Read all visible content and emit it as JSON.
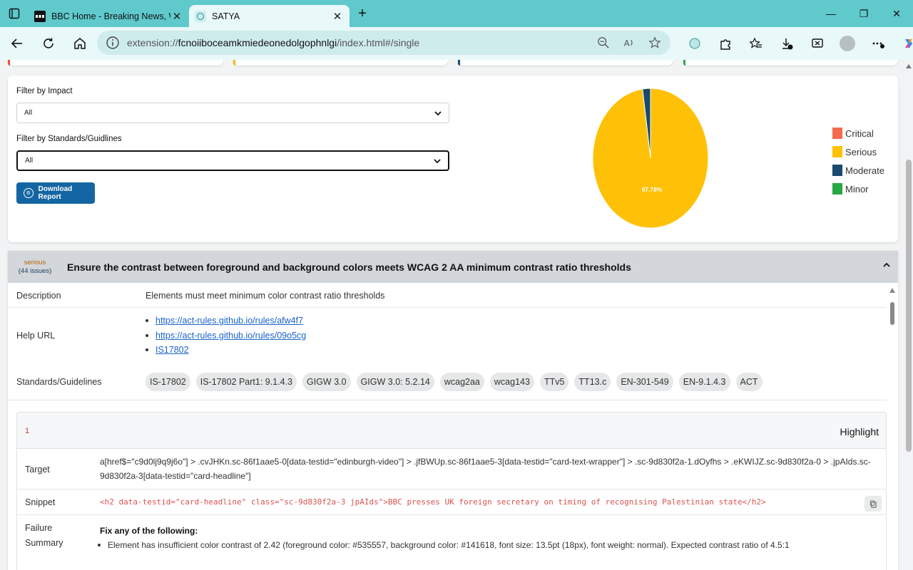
{
  "browser": {
    "tabs": [
      {
        "title": "BBC Home - Breaking News, World",
        "active": false
      },
      {
        "title": "SATYA",
        "active": true
      }
    ],
    "url_prefix": "extension://",
    "url_host": "fcnoiiboceamkmiedeonedolgophnlgi",
    "url_path": "/index.html#/single"
  },
  "filters": {
    "impact_label": "Filter by Impact",
    "impact_value": "All",
    "standards_label": "Filter by Standards/Guidlines",
    "standards_value": "All",
    "download_label": "Download Report"
  },
  "chart_data": {
    "type": "pie",
    "categories": [
      "Critical",
      "Serious",
      "Moderate",
      "Minor"
    ],
    "values": [
      0,
      97.78,
      2.22,
      0
    ],
    "slice_label": "97.78%",
    "colors": [
      "#f46a4e",
      "#ffc107",
      "#1a4a6e",
      "#28a745"
    ],
    "legend_position": "right"
  },
  "rule": {
    "impact": "serious",
    "count": "(44 issues)",
    "title": "Ensure the contrast between foreground and background colors meets WCAG 2 AA minimum contrast ratio thresholds",
    "description_label": "Description",
    "description": "Elements must meet minimum color contrast ratio thresholds",
    "help_label": "Help URL",
    "help_links": [
      "https://act-rules.github.io/rules/afw4f7",
      "https://act-rules.github.io/rules/09o5cg",
      "IS17802"
    ],
    "standards_label": "Standards/Guidelines",
    "standards": [
      "IS-17802",
      "IS-17802 Part1: 9.1.4.3",
      "GIGW 3.0",
      "GIGW 3.0: 5.2.14",
      "wcag2aa",
      "wcag143",
      "TTv5",
      "TT13.c",
      "EN-301-549",
      "EN-9.1.4.3",
      "ACT"
    ]
  },
  "node": {
    "number": "1",
    "highlight_label": "Highlight",
    "target_label": "Target",
    "target": "a[href$=\"c9d0lj9q9j6o\"] > .cvJHKn.sc-86f1aae5-0[data-testid=\"edinburgh-video\"] > .jfBWUp.sc-86f1aae5-3[data-testid=\"card-text-wrapper\"] > .sc-9d830f2a-1.dOyfhs > .eKWIJZ.sc-9d830f2a-0 > .jpAIds.sc-9d830f2a-3[data-testid=\"card-headline\"]",
    "snippet_label": "Snippet",
    "snippet": "<h2 data-testid=\"card-headline\" class=\"sc-9d830f2a-3 jpAIds\">BBC presses UK foreign secretary on timing of recognising Palestinian state</h2>",
    "failure_label_1": "Failure",
    "failure_label_2": "Summary",
    "failure_heading": "Fix any of the following:",
    "failure_item": "Element has insufficient color contrast of 2.42 (foreground color: #535557, background color: #141618, font size: 13.5pt (18px), font weight: normal). Expected contrast ratio of 4.5:1"
  }
}
